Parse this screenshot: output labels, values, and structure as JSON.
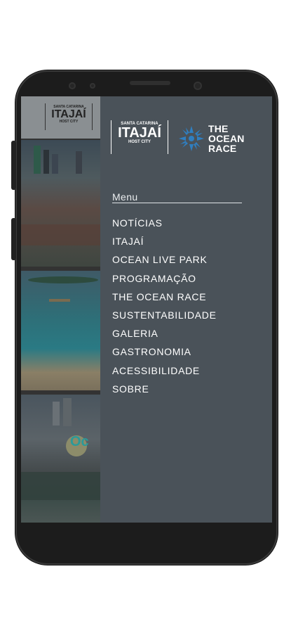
{
  "background_app": {
    "logo": {
      "line1": "SANTA CATARINA",
      "line2": "ITAJAÍ",
      "line3": "HOST CITY"
    },
    "tile_overlay_text": "Oc"
  },
  "drawer": {
    "host_logo": {
      "line1": "SANTA CATARINA",
      "line2": "ITAJAÍ",
      "line3": "HOST CITY"
    },
    "race_logo": {
      "line1": "THE",
      "line2": "OCEAN",
      "line3": "RACE"
    },
    "menu_heading": "Menu",
    "menu_items": [
      "NOTÍCIAS",
      "ITAJAÍ",
      "OCEAN LIVE PARK",
      "PROGRAMAÇÃO",
      "THE OCEAN RACE",
      "SUSTENTABILIDADE",
      "GALERIA",
      "GASTRONOMIA",
      "ACESSIBILIDADE",
      "SOBRE"
    ]
  },
  "navbar": {
    "back_icon": "back-triangle-icon",
    "home_icon": "home-circle-icon",
    "recents_icon": "recents-square-icon"
  },
  "colors": {
    "drawer_bg": "#4a5259",
    "ocean_race_blue": "#2f7fc1",
    "text": "#ffffff"
  }
}
